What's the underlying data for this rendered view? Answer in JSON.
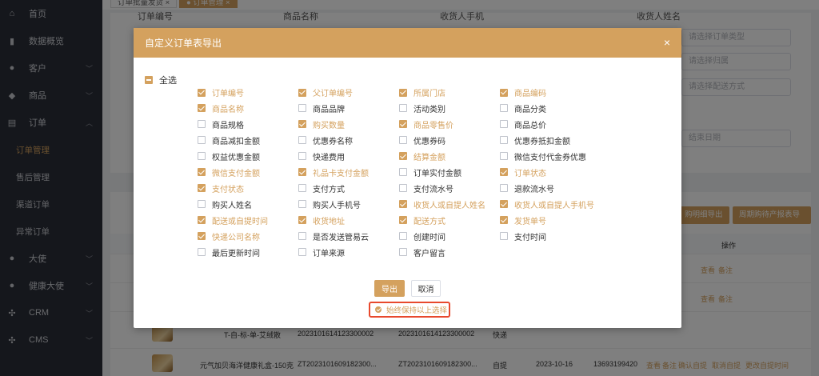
{
  "sidebar": {
    "items": [
      {
        "label": "首页",
        "icon": "home-icon",
        "glyph": "⌂"
      },
      {
        "label": "数据概览",
        "icon": "bar-chart-icon",
        "glyph": "▮"
      },
      {
        "label": "客户",
        "icon": "user-icon",
        "glyph": "●",
        "chevron": "﹀"
      },
      {
        "label": "商品",
        "icon": "diamond-icon",
        "glyph": "◆",
        "chevron": "﹀"
      },
      {
        "label": "订单",
        "icon": "clipboard-icon",
        "glyph": "▤",
        "chevron": "︿"
      },
      {
        "label": "订单管理",
        "sub": true,
        "active": true
      },
      {
        "label": "售后管理",
        "sub": true
      },
      {
        "label": "渠道订单",
        "sub": true
      },
      {
        "label": "异常订单",
        "sub": true
      },
      {
        "label": "大使",
        "icon": "person-icon",
        "glyph": "●",
        "chevron": "﹀"
      },
      {
        "label": "健康大使",
        "icon": "person-icon",
        "glyph": "●",
        "chevron": "﹀"
      },
      {
        "label": "CRM",
        "icon": "grid-icon",
        "glyph": "✣",
        "chevron": "﹀"
      },
      {
        "label": "CMS",
        "icon": "grid-icon",
        "glyph": "✣",
        "chevron": "﹀"
      }
    ]
  },
  "tabs": [
    {
      "label": "订单批量发货 ×"
    },
    {
      "label": "● 订单管理 ×",
      "active": true
    }
  ],
  "filters": {
    "order_no_label": "订单编号",
    "product_name_label": "商品名称",
    "receiver_phone_label": "收货人手机",
    "receiver_addr_label": "收货人姓名",
    "order_type_placeholder": "请选择订单类型",
    "belong_placeholder": "请选择归属",
    "delivery_placeholder": "请选择配送方式",
    "end_date_placeholder": "结束日期"
  },
  "table": {
    "export_detail_btn": "购明细导出",
    "export_periodic_btn": "周期购待产报表导出",
    "ops_header": "操作",
    "rows": [
      {
        "links": [
          "查看",
          "备注"
        ]
      },
      {
        "links": [
          "查看",
          "备注"
        ]
      },
      {
        "name": "T-自-标-单-艾绒散",
        "order_no": "2023101614123300002",
        "parent_no": "2023101614123300002",
        "delivery": "快递",
        "links": []
      },
      {
        "name": "元气加贝海洋健康礼盒-150克",
        "order_no": "ZT2023101609182300...",
        "parent_no": "ZT2023101609182300...",
        "delivery": "自提",
        "date": "2023-10-16",
        "phone": "13693199420",
        "links": [
          "查看",
          "备注",
          "确认自提",
          "取消自提",
          "更改自提时间"
        ]
      }
    ]
  },
  "modal": {
    "title": "自定义订单表导出",
    "close": "×",
    "select_all": "全选",
    "options": [
      [
        "订单编号",
        true
      ],
      [
        "父订单编号",
        true
      ],
      [
        "所属门店",
        true
      ],
      [
        "商品编码",
        true
      ],
      [
        "商品名称",
        true
      ],
      [
        "商品品牌",
        false
      ],
      [
        "活动类别",
        false
      ],
      [
        "商品分类",
        false
      ],
      [
        "商品规格",
        false
      ],
      [
        "购买数量",
        true
      ],
      [
        "商品零售价",
        true
      ],
      [
        "商品总价",
        false
      ],
      [
        "商品减扣金额",
        false
      ],
      [
        "优惠券名称",
        false
      ],
      [
        "优惠券码",
        false
      ],
      [
        "优惠券抵扣金额",
        false
      ],
      [
        "权益优惠金额",
        false
      ],
      [
        "快递费用",
        false
      ],
      [
        "结算金额",
        true
      ],
      [
        "微信支付代金券优惠",
        false
      ],
      [
        "微信支付金额",
        true
      ],
      [
        "礼品卡支付金额",
        true
      ],
      [
        "订单实付金额",
        false
      ],
      [
        "订单状态",
        true
      ],
      [
        "支付状态",
        true
      ],
      [
        "支付方式",
        false
      ],
      [
        "支付流水号",
        false
      ],
      [
        "退款流水号",
        false
      ],
      [
        "购买人姓名",
        false
      ],
      [
        "购买人手机号",
        false
      ],
      [
        "收货人或自提人姓名",
        true
      ],
      [
        "收货人或自提人手机号",
        true
      ],
      [
        "配送或自提时间",
        true
      ],
      [
        "收货地址",
        true
      ],
      [
        "配送方式",
        true
      ],
      [
        "发货单号",
        true
      ],
      [
        "快递公司名称",
        true
      ],
      [
        "是否发送管易云",
        false
      ],
      [
        "创建时间",
        false
      ],
      [
        "支付时间",
        false
      ],
      [
        "最后更新时间",
        false
      ],
      [
        "订单来源",
        false
      ],
      [
        "客户留言",
        false
      ]
    ],
    "export_label": "导出",
    "cancel_label": "取消",
    "keep_selection_label": "始终保持以上选择",
    "keep_selection_checked": true
  },
  "colors": {
    "accent": "#d4a15e",
    "sidebar_bg": "#2b2f38",
    "highlight_border": "#e8492d"
  }
}
